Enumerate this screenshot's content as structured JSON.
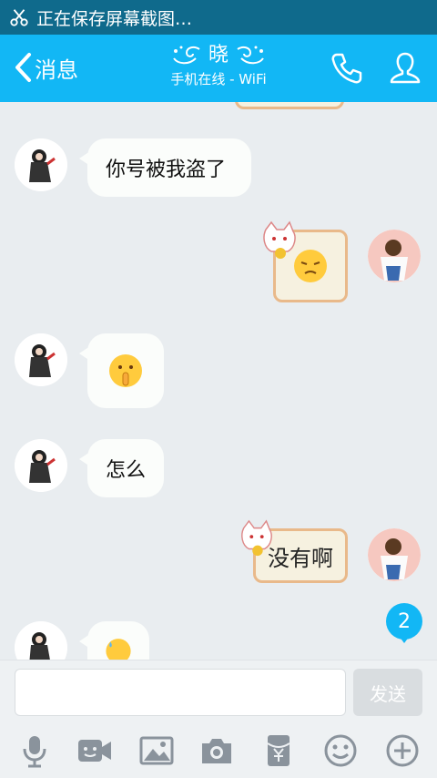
{
  "status_bar": {
    "text": "正在保存屏幕截图…"
  },
  "header": {
    "back_label": "消息",
    "contact_name": "晓",
    "contact_status": "手机在线 - WiFi"
  },
  "messages": [
    {
      "side": "left",
      "type": "text",
      "text": "你号被我盗了"
    },
    {
      "side": "right",
      "type": "sticker-emoji",
      "emoji": "pensive-face"
    },
    {
      "side": "left",
      "type": "emoji",
      "emoji": "shushing-face"
    },
    {
      "side": "left",
      "type": "text",
      "text": "怎么"
    },
    {
      "side": "right",
      "type": "sticker-text",
      "text": "没有啊"
    },
    {
      "side": "left",
      "type": "emoji",
      "emoji": "sweat-face"
    }
  ],
  "unread_badge": "2",
  "composer": {
    "placeholder": "",
    "send_label": "发送"
  },
  "toolbar": [
    "microphone-icon",
    "video-icon",
    "image-icon",
    "camera-icon",
    "red-packet-icon",
    "emoji-icon",
    "plus-icon"
  ],
  "colors": {
    "accent": "#12b7f5",
    "status_bar": "#0f6a8c",
    "background": "#e9edf0"
  }
}
